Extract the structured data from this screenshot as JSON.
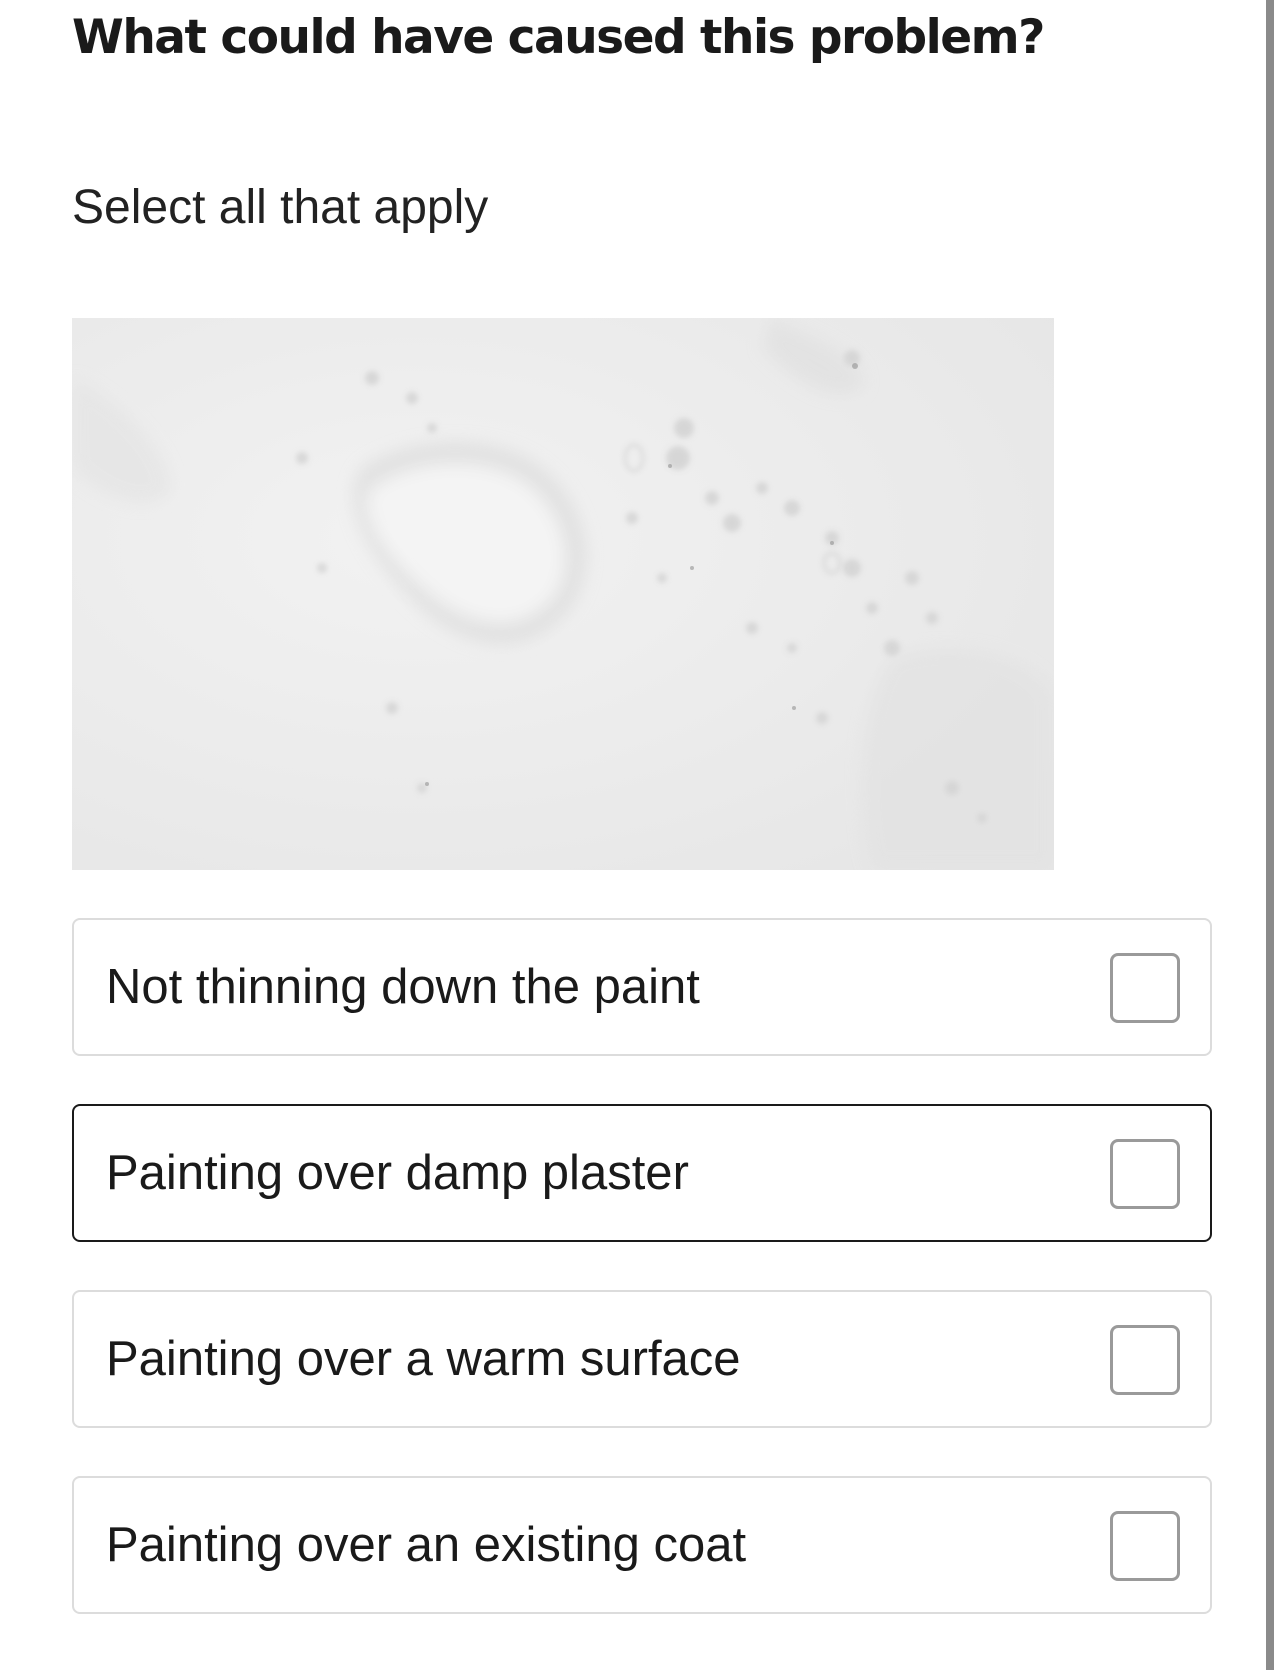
{
  "question": {
    "title": "What could have caused this problem?",
    "instruction": "Select all that apply"
  },
  "image": {
    "subject": "wall-surface-photo"
  },
  "options": [
    {
      "label": "Not thinning down the paint",
      "checked": false
    },
    {
      "label": "Painting over damp plaster",
      "checked": false
    },
    {
      "label": "Painting over a warm surface",
      "checked": false
    },
    {
      "label": "Painting over an existing coat",
      "checked": false
    }
  ],
  "colors": {
    "text": "#1a1a1a",
    "option_border": "#dcdcdc",
    "option_border_active": "#1a1a1a",
    "checkbox_border": "#9a9a9a",
    "scrollbar": "#8a8a8a"
  }
}
